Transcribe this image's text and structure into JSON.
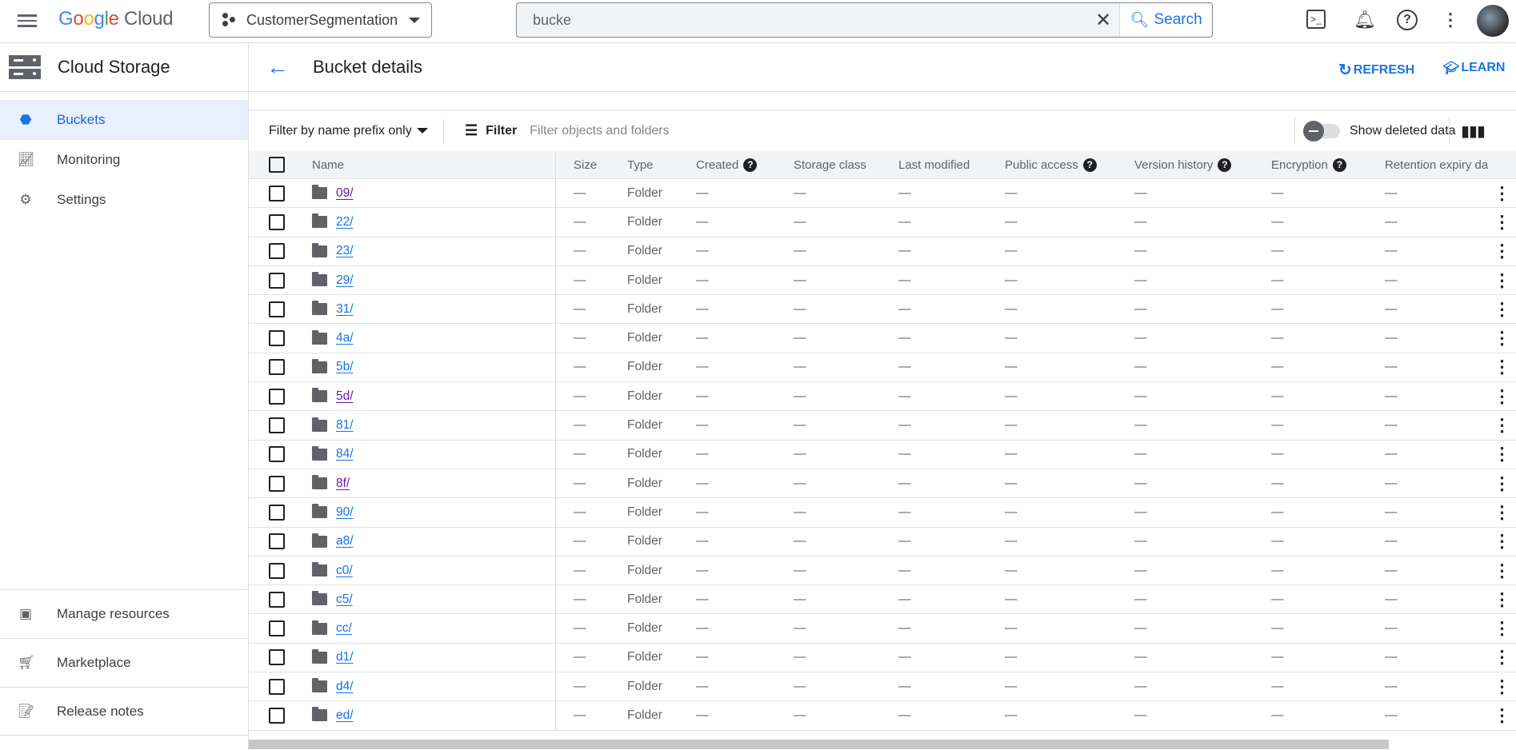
{
  "topbar": {
    "logo": "Google Cloud",
    "project": "CustomerSegmentation",
    "search_value": "bucke",
    "search_label": "Search"
  },
  "sidebar": {
    "title": "Cloud Storage",
    "items": [
      {
        "label": "Buckets",
        "icon": "bucket-icon",
        "active": true
      },
      {
        "label": "Monitoring",
        "icon": "monitoring-icon"
      },
      {
        "label": "Settings",
        "icon": "gear-icon"
      }
    ],
    "bottom": [
      {
        "label": "Manage resources",
        "icon": "manage-resources-icon"
      },
      {
        "label": "Marketplace",
        "icon": "cart-icon"
      },
      {
        "label": "Release notes",
        "icon": "notes-icon"
      }
    ]
  },
  "header": {
    "title": "Bucket details",
    "refresh": "REFRESH",
    "learn": "LEARN"
  },
  "filterbar": {
    "prefix": "Filter by name prefix only",
    "filter": "Filter",
    "placeholder": "Filter objects and folders",
    "show_deleted": "Show deleted data"
  },
  "table": {
    "columns": [
      "Name",
      "Size",
      "Type",
      "Created",
      "Storage class",
      "Last modified",
      "Public access",
      "Version history",
      "Encryption",
      "Retention expiry da"
    ],
    "rows": [
      {
        "name": "09/",
        "visited": true
      },
      {
        "name": "22/"
      },
      {
        "name": "23/"
      },
      {
        "name": "29/"
      },
      {
        "name": "31/"
      },
      {
        "name": "4a/"
      },
      {
        "name": "5b/"
      },
      {
        "name": "5d/",
        "visited": true
      },
      {
        "name": "81/"
      },
      {
        "name": "84/"
      },
      {
        "name": "8f/",
        "visited": true
      },
      {
        "name": "90/"
      },
      {
        "name": "a8/"
      },
      {
        "name": "c0/"
      },
      {
        "name": "c5/"
      },
      {
        "name": "cc/"
      },
      {
        "name": "d1/"
      },
      {
        "name": "d4/"
      },
      {
        "name": "ed/"
      }
    ],
    "type_value": "Folder",
    "empty_value": "—"
  },
  "colors": {
    "accent": "#1a73e8",
    "visited": "#681da8",
    "active_bg": "#e8f0fe"
  }
}
